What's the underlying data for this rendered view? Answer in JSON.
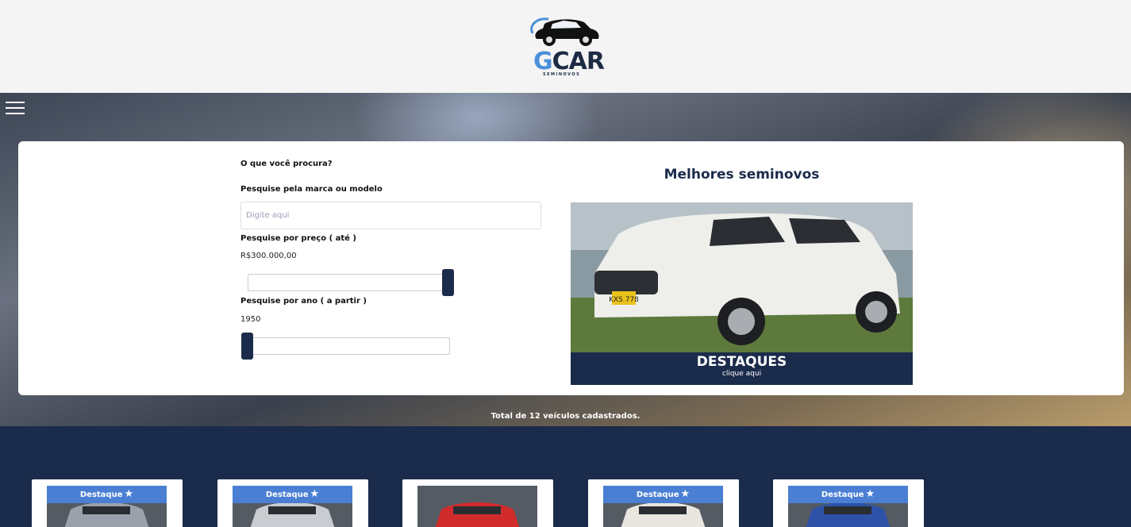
{
  "header": {
    "logo_main_g": "G",
    "logo_main_rest": "CAR",
    "logo_sub": "SEMINOVOS"
  },
  "search": {
    "question": "O que você procura?",
    "brand_label": "Pesquise pela marca ou modelo",
    "brand_placeholder": "Digite aqui",
    "price_label": "Pesquise por preço ( até )",
    "price_value": "R$300.000,00",
    "price_level": 1.0,
    "year_label": "Pesquise por ano ( a partir )",
    "year_value": "1950",
    "year_level": 0.0
  },
  "featured": {
    "title": "Melhores seminovos",
    "banner_title": "DESTAQUES",
    "banner_link": "clique aqui",
    "plate_text": "KXS 778"
  },
  "summary": {
    "total_text": "Total de 12 veículos cadastrados."
  },
  "cards": [
    {
      "badge": "Destaque",
      "featured": true,
      "car_color": "#9aa1aa"
    },
    {
      "badge": "Destaque",
      "featured": true,
      "car_color": "#c9ccd0"
    },
    {
      "badge": "",
      "featured": false,
      "car_color": "#d22b2b"
    },
    {
      "badge": "Destaque",
      "featured": true,
      "car_color": "#e8e6df"
    },
    {
      "badge": "Destaque",
      "featured": true,
      "car_color": "#2d52a8"
    }
  ],
  "colors": {
    "navy": "#1b2b4b",
    "accent_blue": "#4a7fd4",
    "logo_blue": "#4a90d9"
  }
}
